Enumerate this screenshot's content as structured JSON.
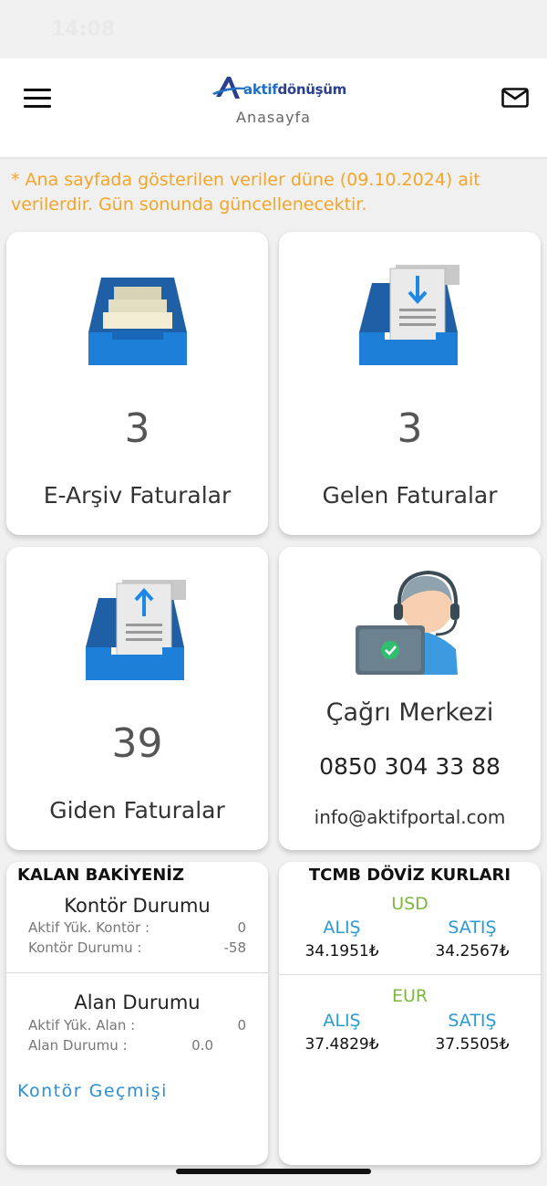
{
  "status_bar": {
    "time": "14:08"
  },
  "header": {
    "brand_part1": "aktif",
    "brand_part2": "dönüşüm",
    "subtitle": "Anasayfa",
    "menu_icon": "hamburger-icon",
    "mail_icon": "mail-icon"
  },
  "notice": "* Ana sayfada gösterilen veriler düne (09.10.2024) ait verilerdir. Gün sonunda güncellenecektir.",
  "tiles": [
    {
      "count": "3",
      "label": "E-Arşiv Faturalar",
      "icon": "archive-tray-icon"
    },
    {
      "count": "3",
      "label": "Gelen Faturalar",
      "icon": "incoming-invoice-icon"
    },
    {
      "count": "39",
      "label": "Giden Faturalar",
      "icon": "outgoing-invoice-icon"
    }
  ],
  "call_center": {
    "title": "Çağrı Merkezi",
    "phone": "0850 304 33 88",
    "email": "info@aktifportal.com",
    "icon": "support-agent-icon"
  },
  "balance": {
    "title": "KALAN BAKİYENİZ",
    "kontor": {
      "title": "Kontör Durumu",
      "rows": [
        {
          "label": "Aktif Yük. Kontör :",
          "value": "0"
        },
        {
          "label": "Kontör Durumu :",
          "value": "-58"
        }
      ]
    },
    "alan": {
      "title": "Alan Durumu",
      "rows": [
        {
          "label": "Aktif Yük. Alan :",
          "value": "0"
        },
        {
          "label": "Alan Durumu :",
          "value": "0.0"
        }
      ]
    },
    "history_link": "Kontör Geçmişi"
  },
  "fx": {
    "title": "TCMB DÖVİZ KURLARI",
    "currencies": [
      {
        "code": "USD",
        "buy_label": "ALIŞ",
        "sell_label": "SATIŞ",
        "buy": "34.1951₺",
        "sell": "34.2567₺"
      },
      {
        "code": "EUR",
        "buy_label": "ALIŞ",
        "sell_label": "SATIŞ",
        "buy": "37.4829₺",
        "sell": "37.5505₺"
      }
    ]
  },
  "colors": {
    "accent_blue": "#2b9ad6",
    "notice_orange": "#f3a52a",
    "currency_green": "#7bb83c",
    "tray_blue": "#1e7fd8"
  }
}
